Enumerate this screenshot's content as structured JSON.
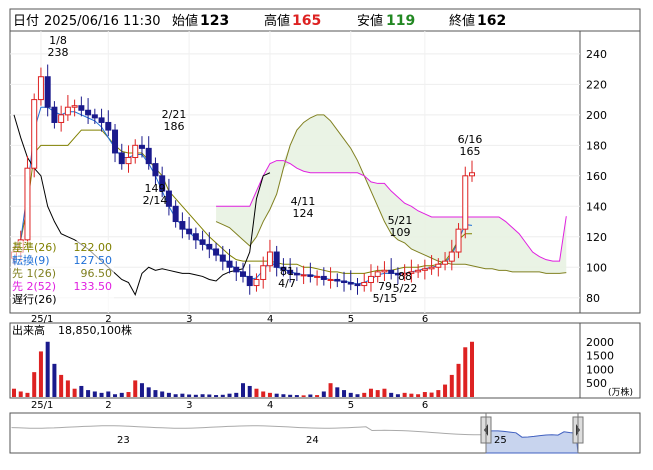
{
  "header": {
    "date_label": "日付",
    "datetime": "2025/06/16 11:30",
    "open_label": "始値",
    "open": "123",
    "high_label": "高値",
    "high": "165",
    "low_label": "安値",
    "low": "119",
    "close_label": "終値",
    "close": "162"
  },
  "colors": {
    "up": "#dd2222",
    "down": "#1a1a8c",
    "kijun": "#808000",
    "tenkan": "#1e6fd6",
    "senko1": "#808020",
    "senko2": "#e020e0",
    "chikou": "#000000",
    "cloud": "#e8f2e2"
  },
  "legend": [
    {
      "label": "基準(26)",
      "value": "122.00",
      "color": "#808000"
    },
    {
      "label": "転換(9)",
      "value": "127.50",
      "color": "#1e6fd6"
    },
    {
      "label": "先 1(26)",
      "value": "96.50",
      "color": "#808020"
    },
    {
      "label": "先 2(52)",
      "value": "133.50",
      "color": "#e020e0"
    },
    {
      "label": "遅行(26)",
      "value": "",
      "color": "#000000"
    }
  ],
  "chart_data": {
    "type": "candlestick",
    "x_tick_labels": [
      "25/1",
      "2",
      "3",
      "4",
      "5",
      "6"
    ],
    "y_ticks": [
      80,
      100,
      120,
      140,
      160,
      180,
      200,
      220,
      240
    ],
    "ylim": [
      70,
      255
    ],
    "annotations": [
      {
        "date": "1/8",
        "value": "238"
      },
      {
        "date": "2/21",
        "value": "186"
      },
      {
        "date": "2/14",
        "value": "149"
      },
      {
        "date": "4/11",
        "value": "124"
      },
      {
        "date": "4/7",
        "value": "81"
      },
      {
        "date": "5/21",
        "value": "109"
      },
      {
        "date": "5/15",
        "value": "79"
      },
      {
        "date": "5/22",
        "value": "88"
      },
      {
        "date": "6/16",
        "value": "165"
      }
    ],
    "price": [
      110,
      118,
      165,
      210,
      225,
      205,
      195,
      200,
      205,
      206,
      203,
      200,
      198,
      195,
      190,
      175,
      168,
      172,
      180,
      178,
      168,
      160,
      150,
      140,
      130,
      125,
      122,
      118,
      115,
      112,
      108,
      104,
      100,
      97,
      94,
      88,
      92,
      101,
      110,
      100,
      98,
      96,
      95,
      95,
      94,
      94,
      92,
      92,
      91,
      90,
      89,
      88,
      90,
      94,
      97,
      98,
      96,
      95,
      96,
      97,
      98,
      99,
      100,
      102,
      104,
      110,
      125,
      160,
      162
    ],
    "tenkan": [
      112,
      118,
      150,
      190,
      205,
      205,
      202,
      200,
      202,
      202,
      200,
      198,
      196,
      192,
      185,
      178,
      172,
      172,
      174,
      174,
      168,
      160,
      150,
      140,
      132,
      127,
      123,
      119,
      116,
      113,
      110,
      106,
      102,
      99,
      96,
      92,
      93,
      98,
      104,
      100,
      99,
      97,
      96,
      95,
      95,
      94,
      93,
      92,
      91,
      91,
      90,
      89,
      90,
      92,
      95,
      96,
      96,
      96,
      96,
      97,
      98,
      99,
      100,
      101,
      103,
      108,
      118,
      128,
      127.5
    ],
    "kijun": [
      115,
      118,
      140,
      175,
      180,
      180,
      180,
      180,
      180,
      185,
      190,
      190,
      190,
      190,
      185,
      180,
      176,
      175,
      175,
      175,
      170,
      165,
      160,
      150,
      145,
      140,
      135,
      130,
      125,
      120,
      116,
      112,
      108,
      105,
      104,
      104,
      104,
      104,
      104,
      103,
      102,
      102,
      102,
      100,
      100,
      99,
      98,
      97,
      97,
      96,
      96,
      96,
      96,
      97,
      98,
      98,
      98,
      99,
      100,
      100,
      100,
      101,
      101,
      102,
      104,
      110,
      118,
      122,
      122
    ],
    "senko1": [
      130,
      128,
      126,
      122,
      118,
      114,
      120,
      130,
      138,
      148,
      165,
      180,
      190,
      195,
      198,
      200,
      200,
      196,
      190,
      184,
      178,
      170,
      160,
      150,
      140,
      130,
      122,
      118,
      116,
      112,
      110,
      108,
      106,
      104,
      103,
      102,
      102,
      102,
      101,
      100,
      99,
      99,
      98,
      98,
      97,
      97,
      97,
      97,
      97,
      96,
      96,
      96,
      96.5
    ],
    "senko2": [
      140,
      140,
      140,
      140,
      140,
      140,
      150,
      160,
      168,
      170,
      170,
      168,
      165,
      163,
      162,
      162,
      162,
      162,
      162,
      162,
      162,
      162,
      160,
      156,
      155,
      155,
      150,
      146,
      142,
      140,
      137,
      135,
      133,
      133,
      133,
      133,
      133,
      133,
      133,
      133,
      133,
      133,
      133,
      130,
      126,
      122,
      116,
      110,
      107,
      105,
      104,
      104,
      133.5
    ],
    "chikou": [
      200,
      185,
      172,
      165,
      160,
      140,
      130,
      122,
      120,
      118,
      115,
      112,
      108,
      104,
      100,
      96,
      92,
      90,
      82,
      96,
      100,
      98,
      99,
      98,
      97,
      96,
      96,
      95,
      94,
      92,
      91,
      95,
      97,
      98,
      99,
      110,
      145,
      160,
      162
    ],
    "volume_label": "出来高",
    "volume_total": "18,850,100株",
    "volume_ticks": [
      500,
      1000,
      1500,
      2000
    ],
    "volume_unit": "(万株)",
    "volume": [
      300,
      200,
      150,
      900,
      1650,
      2000,
      1200,
      800,
      600,
      300,
      400,
      250,
      200,
      150,
      200,
      100,
      150,
      180,
      600,
      500,
      350,
      250,
      200,
      150,
      100,
      120,
      90,
      80,
      100,
      90,
      70,
      80,
      120,
      150,
      500,
      400,
      300,
      200,
      150,
      120,
      100,
      80,
      70,
      60,
      90,
      70,
      200,
      500,
      350,
      250,
      150,
      100,
      150,
      300,
      250,
      300,
      150,
      100,
      150,
      120,
      100,
      180,
      160,
      250,
      450,
      800,
      1200,
      1800,
      2000
    ],
    "nav_labels": [
      "23",
      "24",
      "25"
    ]
  }
}
